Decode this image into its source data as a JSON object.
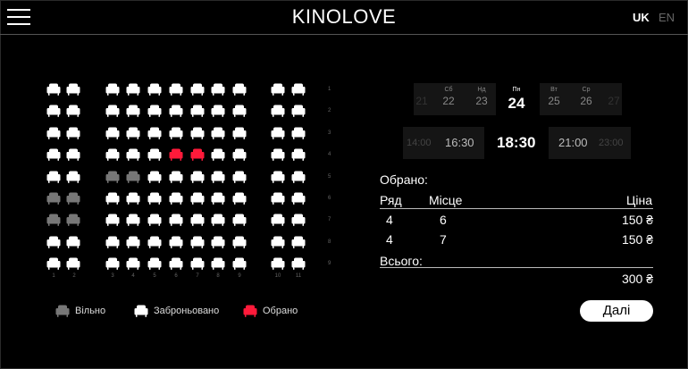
{
  "header": {
    "title": "KINOLOVE",
    "lang_uk": "UK",
    "lang_en": "EN"
  },
  "colors": {
    "free": "#777777",
    "booked": "#ffffff",
    "selected": "#ff1a3a"
  },
  "hall": {
    "col_numbers": [
      "1",
      "2",
      "3",
      "4",
      "5",
      "6",
      "7",
      "8",
      "9",
      "10",
      "11"
    ],
    "row_numbers": [
      "1",
      "2",
      "3",
      "4",
      "5",
      "6",
      "7",
      "8",
      "9"
    ],
    "seats_by_row": [
      [
        "B",
        "B",
        "B",
        "B",
        "B",
        "B",
        "B",
        "B",
        "B",
        "B",
        "B"
      ],
      [
        "B",
        "B",
        "B",
        "B",
        "B",
        "B",
        "B",
        "B",
        "B",
        "B",
        "B"
      ],
      [
        "B",
        "B",
        "B",
        "B",
        "B",
        "B",
        "B",
        "B",
        "B",
        "B",
        "B"
      ],
      [
        "B",
        "B",
        "B",
        "B",
        "B",
        "S",
        "S",
        "B",
        "B",
        "B",
        "B"
      ],
      [
        "B",
        "B",
        "F",
        "F",
        "B",
        "B",
        "B",
        "B",
        "B",
        "B",
        "B"
      ],
      [
        "F",
        "F",
        "B",
        "B",
        "B",
        "B",
        "B",
        "B",
        "B",
        "B",
        "B"
      ],
      [
        "F",
        "F",
        "B",
        "B",
        "B",
        "B",
        "B",
        "B",
        "B",
        "B",
        "B"
      ],
      [
        "B",
        "B",
        "B",
        "B",
        "B",
        "B",
        "B",
        "B",
        "B",
        "B",
        "B"
      ],
      [
        "B",
        "B",
        "B",
        "B",
        "B",
        "B",
        "B",
        "B",
        "B",
        "B",
        "B"
      ]
    ]
  },
  "legend": {
    "free": "Вільно",
    "booked": "Заброньовано",
    "selected": "Обрано"
  },
  "dates": [
    {
      "weekday": "",
      "day": "21",
      "state": "dim"
    },
    {
      "weekday": "Сб",
      "day": "22",
      "state": "normal"
    },
    {
      "weekday": "Нд",
      "day": "23",
      "state": "normal"
    },
    {
      "weekday": "Пн",
      "day": "24",
      "state": "selected"
    },
    {
      "weekday": "Вт",
      "day": "25",
      "state": "normal"
    },
    {
      "weekday": "Ср",
      "day": "26",
      "state": "normal"
    },
    {
      "weekday": "",
      "day": "27",
      "state": "dim"
    }
  ],
  "times": [
    {
      "label": "14:00",
      "state": "dim"
    },
    {
      "label": "16:30",
      "state": "normal"
    },
    {
      "label": "18:30",
      "state": "selected"
    },
    {
      "label": "21:00",
      "state": "normal"
    },
    {
      "label": "23:00",
      "state": "dim"
    }
  ],
  "summary": {
    "title": "Обрано:",
    "col_row": "Ряд",
    "col_seat": "Місце",
    "col_price": "Ціна",
    "rows": [
      {
        "row": "4",
        "seat": "6",
        "price": "150 ₴"
      },
      {
        "row": "4",
        "seat": "7",
        "price": "150 ₴"
      }
    ],
    "total_label": "Всього:",
    "total_value": "300 ₴"
  },
  "next_button": "Далі"
}
